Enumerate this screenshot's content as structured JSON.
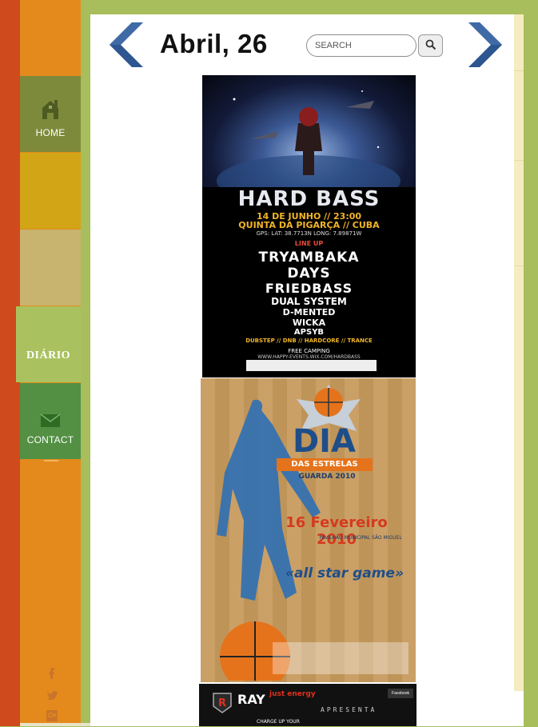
{
  "navigation": {
    "home_label": "HOME",
    "diario_label": "DIÁRIO",
    "contact_label": "CONTACT"
  },
  "header": {
    "date_title": "Abril, 26"
  },
  "search": {
    "placeholder": "SEARCH"
  },
  "social": [
    "facebook-icon",
    "twitter-icon",
    "google-plus-icon"
  ],
  "posters": [
    {
      "title": "HARD BASS",
      "date": "14 DE JUNHO // 23:00",
      "venue": "QUINTA DA PIGARÇA // CUBA",
      "gps": "GPS: LAT: 38.7713N LONG: 7.89871W",
      "lineup_heading": "LINE UP",
      "artists": [
        "TRYAMBAKA",
        "DAYS",
        "FRIEDBASS",
        "DUAL SYSTEM",
        "D-MENTED",
        "WICKA",
        "APSYB"
      ],
      "genres": "DUBSTEP // DNB // HARDCORE // TRANCE",
      "camping": "FREE CAMPING",
      "website": "WWW.HAPPY-EVENTS.WIX.COM/HARDBASS"
    },
    {
      "title": "DIA",
      "ribbon": "DAS ESTRELAS",
      "subtitle": "GUARDA 2010",
      "date": "16 Fevereiro 2010",
      "venue": "PAVILHÃO MUNICIPAL SÃO MIGUEL",
      "game": "«all star game»"
    },
    {
      "brand": "RAY",
      "brand_sub": "just energy",
      "presents": "APRESENTA",
      "social_badge": "Facebook",
      "tagline": "CHARGE UP YOUR"
    }
  ],
  "colors": {
    "left_stripe": "#cf4a1c",
    "sidebar_orange": "#e48a1c",
    "home_tile": "#7e8a3b",
    "yellow_tile": "#d2a517",
    "tan_tile": "#c8b46f",
    "diario_tile": "#a9c25f",
    "contact_tile": "#539043",
    "page_background": "#a8be5c",
    "nav_arrow": "#2d5690"
  }
}
